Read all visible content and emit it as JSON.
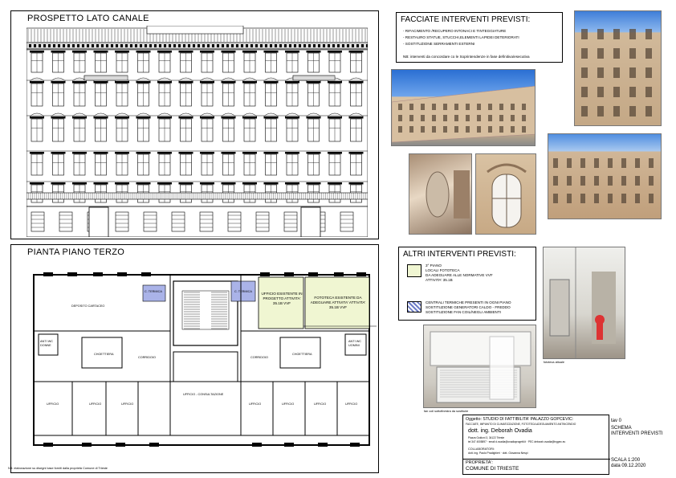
{
  "facade": {
    "title": "PROSPETTO LATO CANALE"
  },
  "plan": {
    "title": "PIANTA PIANO TERZO",
    "rooms": {
      "deposito": "DEPOSITO CARTACEO",
      "c_termica_1": "C. TERMICA",
      "c_termica_2": "C. TERMICA",
      "ufficio_esistente": "UFFICIO ESISTENTE IN PROGETTO ATTIVITA' 35.1B VVF",
      "fototeca": "FOTOTECA ESISTENTE DA ADEGUARE ATTIVITA' ATTIVITA' 35.1B VVF",
      "choettiera_left": "CHOETTIERA",
      "choettiera_right": "CHOETTIERA",
      "corridoio_left": "CORRIDOIO",
      "corridoio_right": "CORRIDOIO",
      "ufficio_consult": "UFFICIO - CONSULTAZIONE",
      "ufficio": "UFFICIO",
      "wc_left": "ANTI WC DONNE",
      "wc_right": "ANTI WC UOMINI"
    }
  },
  "facciate": {
    "title": "FACCIATE INTERVENTI PREVISTI:",
    "items": [
      "- RIFACIMENTO /RECUPERO INTONACI E TINTEGGIATURE",
      "- RESTAURO STATUE, STUCCHI,ELEMENTI LAPIDEI DETERIORATI",
      "- SOSTITUZIONE SERRAMENTI ESTERNI"
    ],
    "note": "NB: interventi da concordare co le Soprintendenze in fase definitiva/esecutiva"
  },
  "altri": {
    "title": "ALTRI INTERVENTI PREVISTI:",
    "legend": [
      {
        "text": "3° PIANO\nLOCALI FOTOTECA\nDA ADEGUARE ALLE NORMATIVE VVF\nATTIVITA' 35.1B",
        "color": "#f0f6d2"
      },
      {
        "text": "CENTRALI TERMICHE PRESENTI IN OGNI PIANO\nSOSTITUZIONE GENERATORI CALDO - FREDDO\nSOSTITUZIONE FAN COIL/NEGLI AMBIENTI",
        "color": "#6f7ec8"
      }
    ]
  },
  "captions": {
    "fototeca": "fototeca attuale",
    "fancoil": "fan coil sottofinestra da sostituire"
  },
  "bottom_note": "NB: elaborazione su disegni base forniti dalla proprietà Comune di Trieste",
  "titleblock": {
    "oggetto_label": "Oggetto:",
    "oggetto": "STUDIO DI FATTIBILITA' PALAZZO GOPCEVIC:",
    "oggetto_sub": "FACCIATE, IMPIANTO DI CLIMATIZZAZIONE, FOTOTECA ADEGUAMENTO ANTINCENDIO",
    "engineer": "dott. ing. Deborah Ovadia",
    "address": "Piazza Goldoni 3, 34122 Trieste",
    "contacts": "tel 347 4005897 · email d.ovadia@ovadiaprogetti.it · PEC deborah.ovadia@ingpec.eu",
    "collab_label": "COLLABORATORI:",
    "collab": "dott. ing. Paolo Pradighieri · dott. Giovanna Nespi",
    "prop_label": "PROPRIETA':",
    "prop": "COMUNE DI TRIESTE",
    "tav": "tav 0",
    "schema_1": "SCHEMA",
    "schema_2": "INTERVENTI PREVISTI",
    "scala": "SCALA 1:200",
    "data": "data 09.12.2020"
  }
}
